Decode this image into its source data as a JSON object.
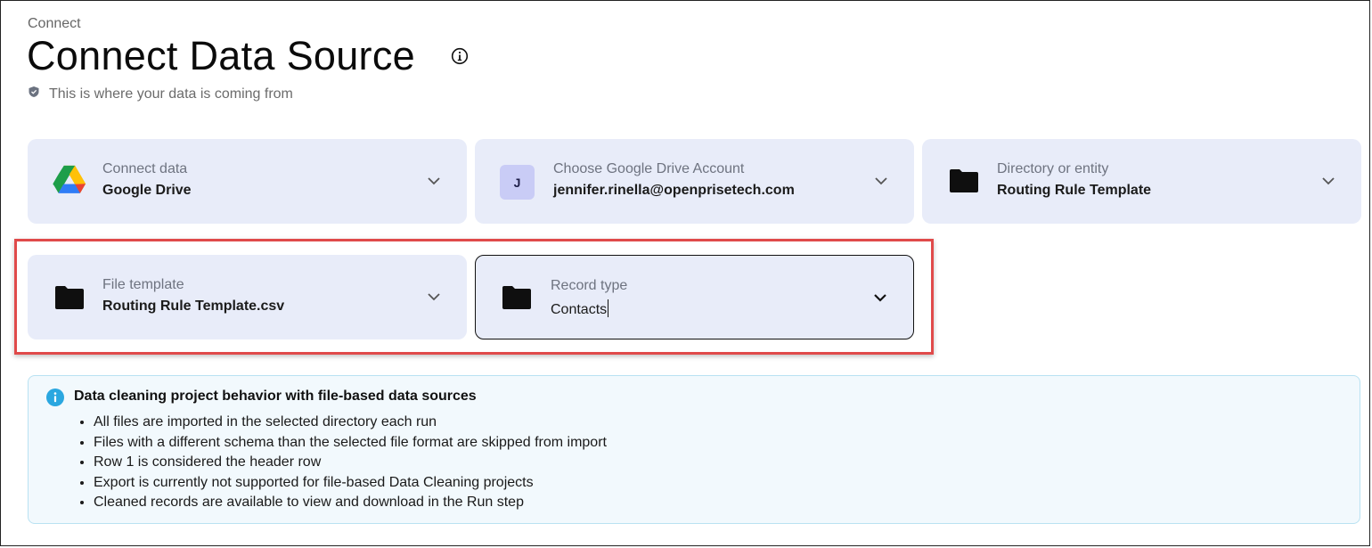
{
  "header": {
    "breadcrumb": "Connect",
    "title": "Connect Data Source",
    "subtitle": "This is where your data is coming from"
  },
  "row1": [
    {
      "label": "Connect data",
      "value": "Google Drive",
      "icon": "google-drive-icon"
    },
    {
      "label": "Choose Google Drive Account",
      "value": "jennifer.rinella@openprisetech.com",
      "avatar": "J"
    },
    {
      "label": "Directory or entity",
      "value": "Routing Rule Template",
      "icon": "folder-icon"
    }
  ],
  "row2": [
    {
      "label": "File template",
      "value": "Routing Rule Template.csv",
      "icon": "folder-icon"
    },
    {
      "label": "Record type",
      "value": "Contacts",
      "icon": "folder-icon"
    }
  ],
  "notice": {
    "title": "Data cleaning project behavior with file-based data sources",
    "items": [
      "All files are imported in the selected directory each run",
      "Files with a different schema than the selected file format are skipped from import",
      "Row 1 is considered the header row",
      "Export is currently not supported for file-based Data Cleaning projects",
      "Cleaned records are available to view and download in the Run step"
    ]
  },
  "colors": {
    "card_bg": "#e8ecf9",
    "highlight": "#e04a4a",
    "notice_bg": "#f2f9fd",
    "info_blue": "#2aa7e0"
  }
}
